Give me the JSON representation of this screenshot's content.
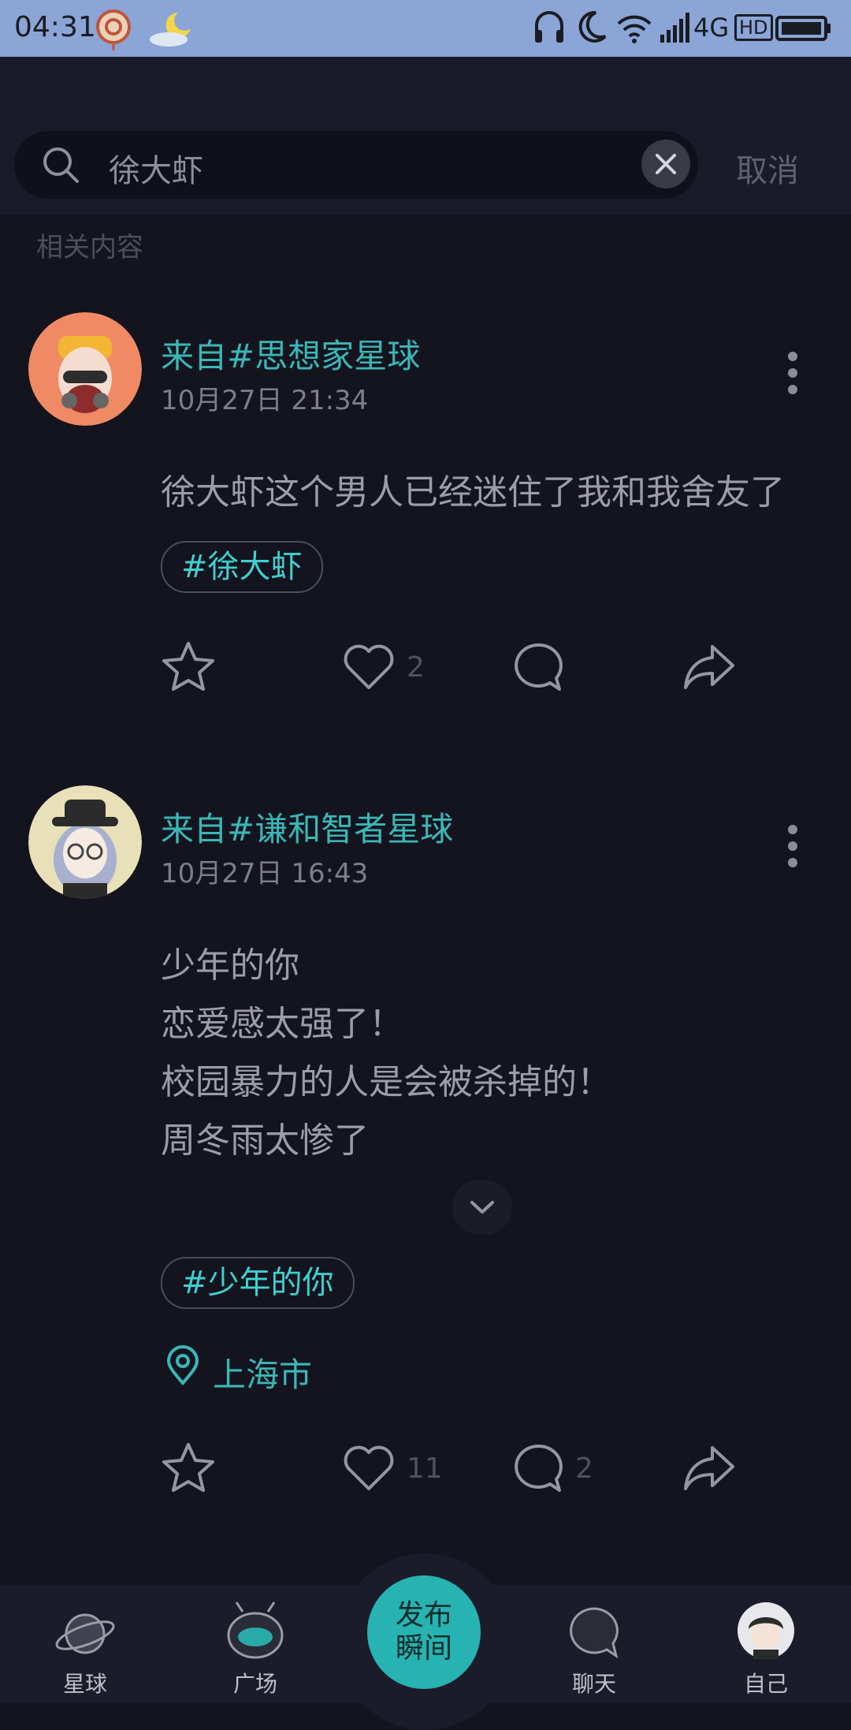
{
  "status": {
    "time": "04:31",
    "network": "4G",
    "hd": "HD"
  },
  "search": {
    "query": "徐大虾",
    "cancel": "取消"
  },
  "section_label": "相关内容",
  "posts": [
    {
      "from": "来自#思想家星球",
      "date": "10月27日 21:34",
      "lines": [
        "徐大虾这个男人已经迷住了我和我舍友了"
      ],
      "tag": "#徐大虾",
      "like_count": "2",
      "comment_count": ""
    },
    {
      "from": "来自#谦和智者星球",
      "date": "10月27日 16:43",
      "lines": [
        "少年的你",
        "恋爱感太强了！",
        "校园暴力的人是会被杀掉的！",
        "周冬雨太惨了"
      ],
      "tag": "#少年的你",
      "location": "上海市",
      "like_count": "11",
      "comment_count": "2"
    }
  ],
  "tabbar": {
    "planet": "星球",
    "square": "广场",
    "publish_line1": "发布",
    "publish_line2": "瞬间",
    "chat": "聊天",
    "me": "自己"
  },
  "colors": {
    "accent": "#3ab7b6",
    "publish": "#27b3b1",
    "background": "#14141f"
  }
}
